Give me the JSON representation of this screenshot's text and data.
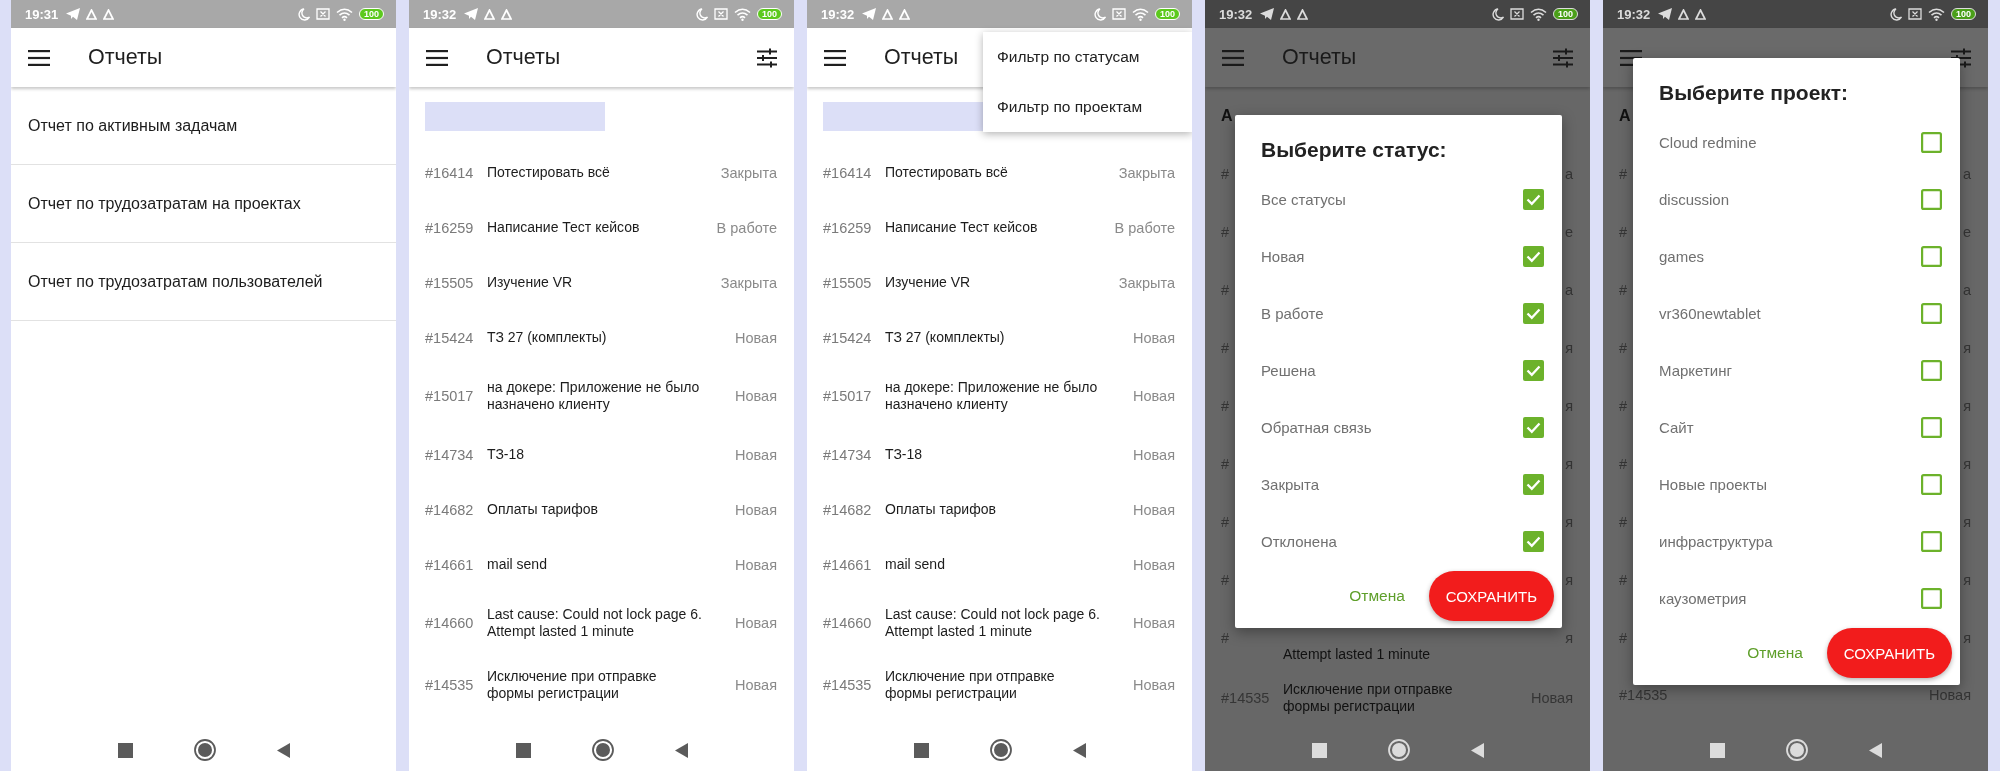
{
  "screens": [
    {
      "status_bar": {
        "time": "19:31",
        "battery": "100"
      },
      "app_bar": {
        "title": "Отчеты"
      },
      "content": {
        "kind": "reports",
        "items": [
          "Отчет по активным задачам",
          "Отчет по трудозатратам на проектах",
          "Отчет по трудозатратам пользователей"
        ]
      }
    },
    {
      "status_bar": {
        "time": "19:32",
        "battery": "100"
      },
      "app_bar": {
        "title": "Отчеты",
        "filter_icon": true
      },
      "content": {
        "kind": "tasks",
        "heading_redacted": true,
        "rows": [
          {
            "kind": "full",
            "id": "#16414",
            "title": "Потестировать всё",
            "status": "Закрыта"
          },
          {
            "kind": "full",
            "id": "#16259",
            "title": "Написание Тест кейсов",
            "status": "В работе"
          },
          {
            "kind": "full",
            "id": "#15505",
            "title": "Изучение VR",
            "status": "Закрыта"
          },
          {
            "kind": "full",
            "id": "#15424",
            "title": "ТЗ 27 (комплекты)",
            "status": "Новая"
          },
          {
            "kind": "full",
            "id": "#15017",
            "title": "на докере: Приложение не было назначено клиенту",
            "status": "Новая"
          },
          {
            "kind": "full",
            "id": "#14734",
            "title": "ТЗ-18",
            "status": "Новая"
          },
          {
            "kind": "full",
            "id": "#14682",
            "title": "Оплаты тарифов",
            "status": "Новая"
          },
          {
            "kind": "full",
            "id": "#14661",
            "title": "mail send",
            "status": "Новая"
          },
          {
            "kind": "full",
            "id": "#14660",
            "title": "Last cause: Could not lock page 6. Attempt lasted 1 minute",
            "status": "Новая"
          },
          {
            "kind": "full",
            "id": "#14535",
            "title": "Исключение при отправке формы регистрации",
            "status": "Новая"
          }
        ]
      }
    },
    {
      "status_bar": {
        "time": "19:32",
        "battery": "100"
      },
      "app_bar": {
        "title": "Отчеты"
      },
      "content": {
        "kind": "tasks",
        "heading_redacted": true,
        "rows": [
          {
            "kind": "full",
            "id": "#16414",
            "title": "Потестировать всё",
            "status": "Закрыта"
          },
          {
            "kind": "full",
            "id": "#16259",
            "title": "Написание Тест кейсов",
            "status": "В работе"
          },
          {
            "kind": "full",
            "id": "#15505",
            "title": "Изучение VR",
            "status": "Закрыта"
          },
          {
            "kind": "full",
            "id": "#15424",
            "title": "ТЗ 27 (комплекты)",
            "status": "Новая"
          },
          {
            "kind": "full",
            "id": "#15017",
            "title": "на докере: Приложение не было назначено клиенту",
            "status": "Новая"
          },
          {
            "kind": "full",
            "id": "#14734",
            "title": "ТЗ-18",
            "status": "Новая"
          },
          {
            "kind": "full",
            "id": "#14682",
            "title": "Оплаты тарифов",
            "status": "Новая"
          },
          {
            "kind": "full",
            "id": "#14661",
            "title": "mail send",
            "status": "Новая"
          },
          {
            "kind": "full",
            "id": "#14660",
            "title": "Last cause: Could not lock page 6. Attempt lasted 1 minute",
            "status": "Новая"
          },
          {
            "kind": "full",
            "id": "#14535",
            "title": "Исключение при отправке формы регистрации",
            "status": "Новая"
          }
        ]
      },
      "menu": {
        "items": [
          "Фильтр по статусам",
          "Фильтр по проектам"
        ]
      }
    },
    {
      "status_bar": {
        "time": "19:32",
        "battery": "100"
      },
      "app_bar": {
        "title": "Отчеты",
        "filter_icon": true
      },
      "content": {
        "kind": "tasks",
        "heading": "А",
        "rows": [
          {
            "kind": "fragment",
            "id": "#",
            "status": "а"
          },
          {
            "kind": "fragment",
            "id": "#",
            "status": "е"
          },
          {
            "kind": "fragment",
            "id": "#",
            "status": "а"
          },
          {
            "kind": "fragment",
            "id": "#",
            "status": "я"
          },
          {
            "kind": "fragment",
            "id": "#",
            "status": "я"
          },
          {
            "kind": "fragment",
            "id": "#",
            "status": "я"
          },
          {
            "kind": "fragment",
            "id": "#",
            "status": "я"
          },
          {
            "kind": "fragment",
            "id": "#",
            "status": "я"
          },
          {
            "kind": "fragment",
            "id": "#",
            "title": "Attempt lasted 1 minute",
            "status": "я"
          },
          {
            "kind": "full",
            "id": "#14535",
            "title": "Исключение при отправке формы регистрации",
            "status": "Новая"
          }
        ]
      },
      "dialog": {
        "title": "Выберите статус:",
        "options": [
          {
            "label": "Все статусы",
            "checked": true
          },
          {
            "label": "Новая",
            "checked": true
          },
          {
            "label": "В работе",
            "checked": true
          },
          {
            "label": "Решена",
            "checked": true
          },
          {
            "label": "Обратная связь",
            "checked": true
          },
          {
            "label": "Закрыта",
            "checked": true
          },
          {
            "label": "Отклонена",
            "checked": true
          }
        ],
        "cancel": "Отмена",
        "save": "СОХРАНИТЬ"
      }
    },
    {
      "status_bar": {
        "time": "19:32",
        "battery": "100"
      },
      "app_bar": {
        "filter_icon": true
      },
      "content": {
        "kind": "tasks",
        "heading": "А",
        "rows": [
          {
            "kind": "fragment",
            "id": "#",
            "status": "а"
          },
          {
            "kind": "fragment",
            "id": "#",
            "status": "е"
          },
          {
            "kind": "fragment",
            "id": "#",
            "status": "а"
          },
          {
            "kind": "fragment",
            "id": "#",
            "status": "я"
          },
          {
            "kind": "fragment",
            "id": "#",
            "status": "я"
          },
          {
            "kind": "fragment",
            "id": "#",
            "status": "я"
          },
          {
            "kind": "fragment",
            "id": "#",
            "status": "я"
          },
          {
            "kind": "fragment",
            "id": "#",
            "status": "я"
          },
          {
            "kind": "fragment",
            "id": "#",
            "status": "я"
          },
          {
            "kind": "full",
            "id": "#14535",
            "status": "Новая"
          }
        ]
      },
      "dialog": {
        "title": "Выберите проект:",
        "options": [
          {
            "label": "Cloud redmine",
            "checked": false
          },
          {
            "label": "discussion",
            "checked": false
          },
          {
            "label": "games",
            "checked": false
          },
          {
            "label": "vr360newtablet",
            "checked": false
          },
          {
            "label": "Маркетинг",
            "checked": false
          },
          {
            "label": "Сайт",
            "checked": false
          },
          {
            "label": "Новые проекты",
            "checked": false
          },
          {
            "label": "инфраструктура",
            "checked": false
          },
          {
            "label": "каузометрия",
            "checked": false
          }
        ],
        "cancel": "Отмена",
        "save": "СОХРАНИТЬ"
      }
    }
  ]
}
